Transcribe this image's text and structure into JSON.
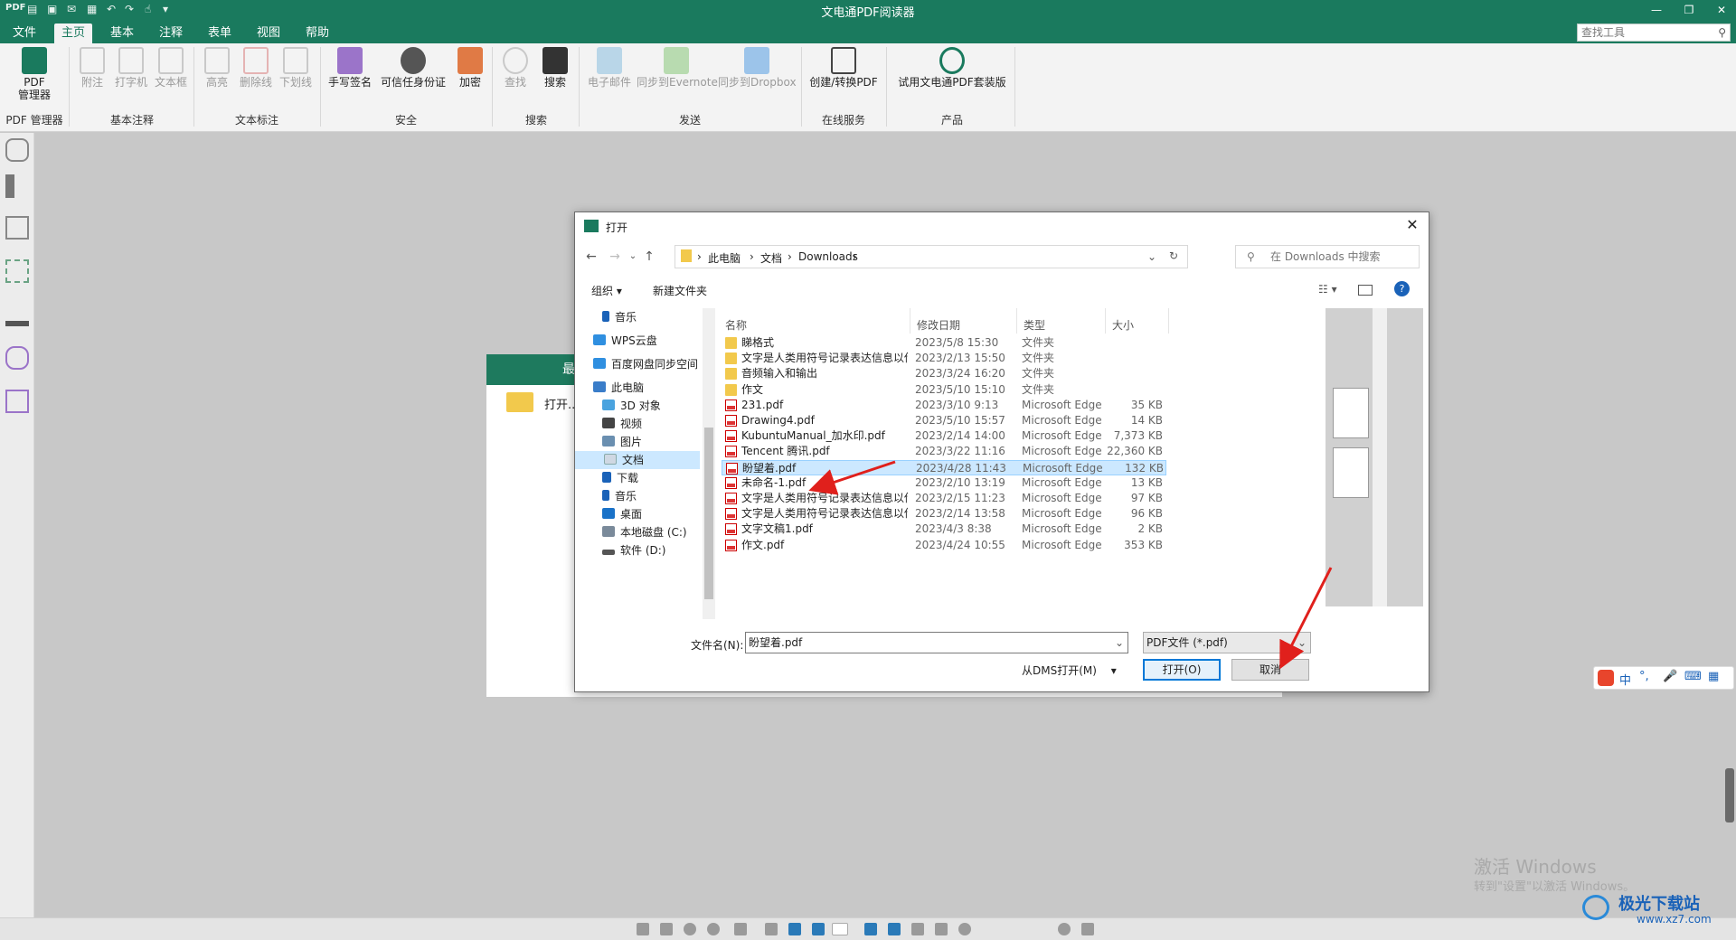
{
  "app": {
    "title": "文电通PDF阅读器"
  },
  "menu": {
    "tabs": [
      "文件",
      "主页",
      "基本",
      "注释",
      "表单",
      "视图",
      "帮助"
    ],
    "active": "主页"
  },
  "tool_search": {
    "placeholder": "查找工具"
  },
  "ribbon": {
    "pdf_manager": "PDF\n管理器",
    "groups": {
      "pdf_manager": "PDF 管理器",
      "basic_annot": "基本注释",
      "text_mark": "文本标注",
      "security": "安全",
      "search": "搜索",
      "send": "发送",
      "online": "在线服务",
      "product": "产品"
    },
    "buttons": {
      "note": "附注",
      "typewriter": "打字机",
      "textbox": "文本框",
      "highlight": "高亮",
      "strikeout": "删除线",
      "underline": "下划线",
      "sign": "手写签名",
      "trusted_id": "可信任身份证",
      "encrypt": "加密",
      "find": "查找",
      "search": "搜索",
      "email": "电子邮件",
      "evernote": "同步到Evernote",
      "dropbox": "同步到Dropbox",
      "create_convert": "创建/转换PDF",
      "trial": "试用文电通PDF套装版"
    }
  },
  "start_panel": {
    "header": "最",
    "open_label": "打开..."
  },
  "dialog": {
    "title": "打开",
    "breadcrumb": [
      "此电脑",
      "文档",
      "Downloads"
    ],
    "search_placeholder": "在 Downloads 中搜索",
    "organize": "组织 ▾",
    "new_folder": "新建文件夹",
    "nav_items": [
      {
        "label": "音乐"
      },
      {
        "label": "WPS云盘"
      },
      {
        "label": "百度网盘同步空间"
      },
      {
        "label": "此电脑"
      },
      {
        "label": "3D 对象"
      },
      {
        "label": "视频"
      },
      {
        "label": "图片"
      },
      {
        "label": "文档"
      },
      {
        "label": "下载"
      },
      {
        "label": "音乐"
      },
      {
        "label": "桌面"
      },
      {
        "label": "本地磁盘 (C:)"
      },
      {
        "label": "软件 (D:)"
      }
    ],
    "columns": {
      "name": "名称",
      "date": "修改日期",
      "type": "类型",
      "size": "大小"
    },
    "files": [
      {
        "name": "睇格式",
        "date": "2023/5/8 15:30",
        "type": "文件夹",
        "size": "",
        "kind": "folder"
      },
      {
        "name": "文字是人类用符号记录表达信息以传之久...",
        "date": "2023/2/13 15:50",
        "type": "文件夹",
        "size": "",
        "kind": "folder"
      },
      {
        "name": "音频输入和输出",
        "date": "2023/3/24 16:20",
        "type": "文件夹",
        "size": "",
        "kind": "folder"
      },
      {
        "name": "作文",
        "date": "2023/5/10 15:10",
        "type": "文件夹",
        "size": "",
        "kind": "folder"
      },
      {
        "name": "231.pdf",
        "date": "2023/3/10 9:13",
        "type": "Microsoft Edge ...",
        "size": "35 KB",
        "kind": "pdf"
      },
      {
        "name": "Drawing4.pdf",
        "date": "2023/5/10 15:57",
        "type": "Microsoft Edge ...",
        "size": "14 KB",
        "kind": "pdf"
      },
      {
        "name": "KubuntuManual_加水印.pdf",
        "date": "2023/2/14 14:00",
        "type": "Microsoft Edge ...",
        "size": "7,373 KB",
        "kind": "pdf"
      },
      {
        "name": "Tencent 腾讯.pdf",
        "date": "2023/3/22 11:16",
        "type": "Microsoft Edge ...",
        "size": "22,360 KB",
        "kind": "pdf"
      },
      {
        "name": "盼望着.pdf",
        "date": "2023/4/28 11:43",
        "type": "Microsoft Edge ...",
        "size": "132 KB",
        "kind": "pdf"
      },
      {
        "name": "未命名-1.pdf",
        "date": "2023/2/10 13:19",
        "type": "Microsoft Edge ...",
        "size": "13 KB",
        "kind": "pdf"
      },
      {
        "name": "文字是人类用符号记录表达信息以传之久...",
        "date": "2023/2/15 11:23",
        "type": "Microsoft Edge ...",
        "size": "97 KB",
        "kind": "pdf"
      },
      {
        "name": "文字是人类用符号记录表达信息以传之久...",
        "date": "2023/2/14 13:58",
        "type": "Microsoft Edge ...",
        "size": "96 KB",
        "kind": "pdf"
      },
      {
        "name": "文字文稿1.pdf",
        "date": "2023/4/3 8:38",
        "type": "Microsoft Edge ...",
        "size": "2 KB",
        "kind": "pdf"
      },
      {
        "name": "作文.pdf",
        "date": "2023/4/24 10:55",
        "type": "Microsoft Edge ...",
        "size": "353 KB",
        "kind": "pdf"
      }
    ],
    "selected_file": "盼望着.pdf",
    "filename_label": "文件名(N):",
    "filename_value": "盼望着.pdf",
    "filetype_value": "PDF文件 (*.pdf)",
    "dms_open": "从DMS打开(M)",
    "open_button": "打开(O)",
    "cancel_button": "取消"
  },
  "watermark": {
    "line1": "激活 Windows",
    "line2": "转到\"设置\"以激活 Windows。"
  },
  "ime": {
    "label": "中"
  },
  "site": {
    "logo": "极光下载站",
    "url": "www.xz7.com"
  },
  "colors": {
    "brand": "#1a7a5e",
    "selection": "#cce8ff",
    "arrow": "#e0201c"
  }
}
